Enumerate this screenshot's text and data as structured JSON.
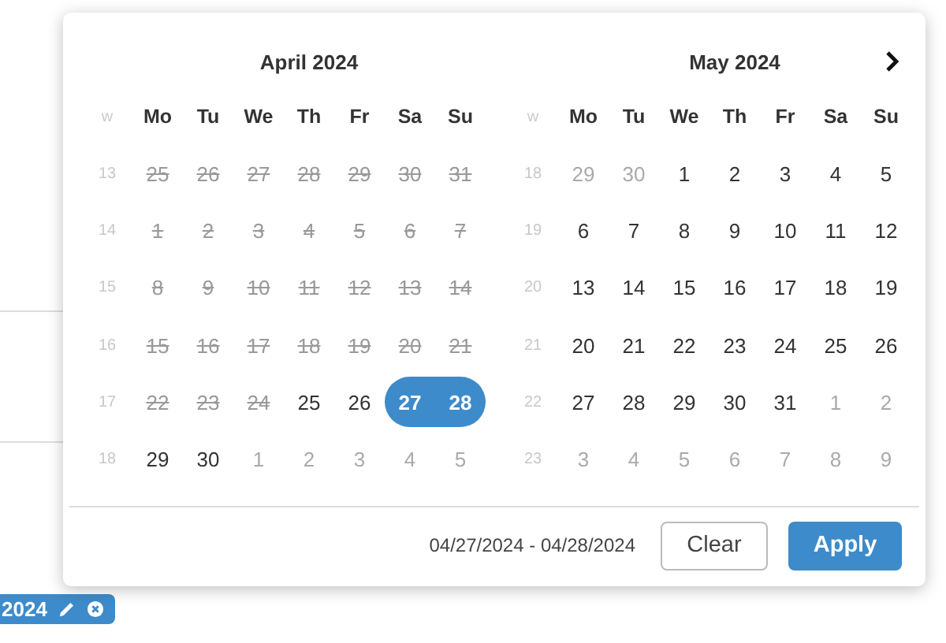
{
  "months": [
    {
      "title": "April 2024",
      "week_label": "w",
      "weekdays": [
        "Mo",
        "Tu",
        "We",
        "Th",
        "Fr",
        "Sa",
        "Su"
      ],
      "weeks": [
        {
          "number": "13",
          "days": [
            {
              "text": "25",
              "kind": "disabled"
            },
            {
              "text": "26",
              "kind": "disabled"
            },
            {
              "text": "27",
              "kind": "disabled"
            },
            {
              "text": "28",
              "kind": "disabled"
            },
            {
              "text": "29",
              "kind": "disabled"
            },
            {
              "text": "30",
              "kind": "disabled"
            },
            {
              "text": "31",
              "kind": "disabled"
            }
          ]
        },
        {
          "number": "14",
          "days": [
            {
              "text": "1",
              "kind": "disabled"
            },
            {
              "text": "2",
              "kind": "disabled"
            },
            {
              "text": "3",
              "kind": "disabled"
            },
            {
              "text": "4",
              "kind": "disabled"
            },
            {
              "text": "5",
              "kind": "disabled"
            },
            {
              "text": "6",
              "kind": "disabled"
            },
            {
              "text": "7",
              "kind": "disabled"
            }
          ]
        },
        {
          "number": "15",
          "days": [
            {
              "text": "8",
              "kind": "disabled"
            },
            {
              "text": "9",
              "kind": "disabled"
            },
            {
              "text": "10",
              "kind": "disabled"
            },
            {
              "text": "11",
              "kind": "disabled"
            },
            {
              "text": "12",
              "kind": "disabled"
            },
            {
              "text": "13",
              "kind": "disabled"
            },
            {
              "text": "14",
              "kind": "disabled"
            }
          ]
        },
        {
          "number": "16",
          "days": [
            {
              "text": "15",
              "kind": "disabled"
            },
            {
              "text": "16",
              "kind": "disabled"
            },
            {
              "text": "17",
              "kind": "disabled"
            },
            {
              "text": "18",
              "kind": "disabled"
            },
            {
              "text": "19",
              "kind": "disabled"
            },
            {
              "text": "20",
              "kind": "disabled"
            },
            {
              "text": "21",
              "kind": "disabled"
            }
          ]
        },
        {
          "number": "17",
          "days": [
            {
              "text": "22",
              "kind": "disabled"
            },
            {
              "text": "23",
              "kind": "disabled"
            },
            {
              "text": "24",
              "kind": "disabled"
            },
            {
              "text": "25",
              "kind": "normal"
            },
            {
              "text": "26",
              "kind": "normal"
            },
            {
              "text": "27",
              "kind": "range_start"
            },
            {
              "text": "28",
              "kind": "range_end"
            }
          ]
        },
        {
          "number": "18",
          "days": [
            {
              "text": "29",
              "kind": "normal"
            },
            {
              "text": "30",
              "kind": "normal"
            },
            {
              "text": "1",
              "kind": "outside"
            },
            {
              "text": "2",
              "kind": "outside"
            },
            {
              "text": "3",
              "kind": "outside"
            },
            {
              "text": "4",
              "kind": "outside"
            },
            {
              "text": "5",
              "kind": "outside"
            }
          ]
        }
      ]
    },
    {
      "title": "May 2024",
      "week_label": "w",
      "weekdays": [
        "Mo",
        "Tu",
        "We",
        "Th",
        "Fr",
        "Sa",
        "Su"
      ],
      "weeks": [
        {
          "number": "18",
          "days": [
            {
              "text": "29",
              "kind": "outside"
            },
            {
              "text": "30",
              "kind": "outside"
            },
            {
              "text": "1",
              "kind": "normal"
            },
            {
              "text": "2",
              "kind": "normal"
            },
            {
              "text": "3",
              "kind": "normal"
            },
            {
              "text": "4",
              "kind": "normal"
            },
            {
              "text": "5",
              "kind": "normal"
            }
          ]
        },
        {
          "number": "19",
          "days": [
            {
              "text": "6",
              "kind": "normal"
            },
            {
              "text": "7",
              "kind": "normal"
            },
            {
              "text": "8",
              "kind": "normal"
            },
            {
              "text": "9",
              "kind": "normal"
            },
            {
              "text": "10",
              "kind": "normal"
            },
            {
              "text": "11",
              "kind": "normal"
            },
            {
              "text": "12",
              "kind": "normal"
            }
          ]
        },
        {
          "number": "20",
          "days": [
            {
              "text": "13",
              "kind": "normal"
            },
            {
              "text": "14",
              "kind": "normal"
            },
            {
              "text": "15",
              "kind": "normal"
            },
            {
              "text": "16",
              "kind": "normal"
            },
            {
              "text": "17",
              "kind": "normal"
            },
            {
              "text": "18",
              "kind": "normal"
            },
            {
              "text": "19",
              "kind": "normal"
            }
          ]
        },
        {
          "number": "21",
          "days": [
            {
              "text": "20",
              "kind": "normal"
            },
            {
              "text": "21",
              "kind": "normal"
            },
            {
              "text": "22",
              "kind": "normal"
            },
            {
              "text": "23",
              "kind": "normal"
            },
            {
              "text": "24",
              "kind": "normal"
            },
            {
              "text": "25",
              "kind": "normal"
            },
            {
              "text": "26",
              "kind": "normal"
            }
          ]
        },
        {
          "number": "22",
          "days": [
            {
              "text": "27",
              "kind": "normal"
            },
            {
              "text": "28",
              "kind": "normal"
            },
            {
              "text": "29",
              "kind": "normal"
            },
            {
              "text": "30",
              "kind": "normal"
            },
            {
              "text": "31",
              "kind": "normal"
            },
            {
              "text": "1",
              "kind": "outside"
            },
            {
              "text": "2",
              "kind": "outside"
            }
          ]
        },
        {
          "number": "23",
          "days": [
            {
              "text": "3",
              "kind": "outside"
            },
            {
              "text": "4",
              "kind": "outside"
            },
            {
              "text": "5",
              "kind": "outside"
            },
            {
              "text": "6",
              "kind": "outside"
            },
            {
              "text": "7",
              "kind": "outside"
            },
            {
              "text": "8",
              "kind": "outside"
            },
            {
              "text": "9",
              "kind": "outside"
            }
          ]
        }
      ]
    }
  ],
  "footer": {
    "range": "04/27/2024 - 04/28/2024",
    "buttons": [
      {
        "label": "Clear",
        "kind": "secondary"
      },
      {
        "label": "Apply",
        "kind": "primary"
      }
    ]
  },
  "filter_chip": {
    "text": "2024"
  }
}
